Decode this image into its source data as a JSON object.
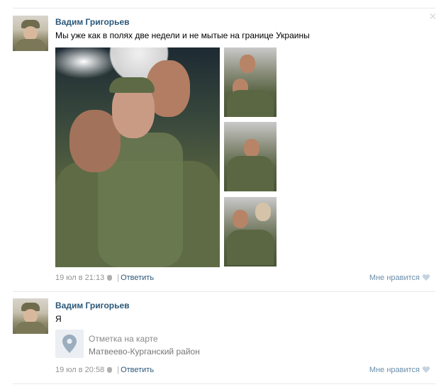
{
  "posts": [
    {
      "author": "Вадим Григорьев",
      "text": "Мы уже как в полях две недели и не мытые на границе Украины",
      "date": "19 юл в 21:13",
      "reply": "Ответить",
      "like": "Мне нравится"
    },
    {
      "author": "Вадим Григорьев",
      "text": "Я",
      "map": {
        "title": "Отметка на карте",
        "place": "Матвеево-Курганский район"
      },
      "date": "19 юл в 20:58",
      "reply": "Ответить",
      "like": "Мне нравится"
    }
  ],
  "icons": {
    "source_icon": "apple-icon",
    "like_icon": "heart-icon",
    "map_icon": "map-pin-icon",
    "close_icon": "close-icon"
  },
  "colors": {
    "link": "#2b587a",
    "meta": "#939393",
    "divider": "#e7e8ec"
  }
}
